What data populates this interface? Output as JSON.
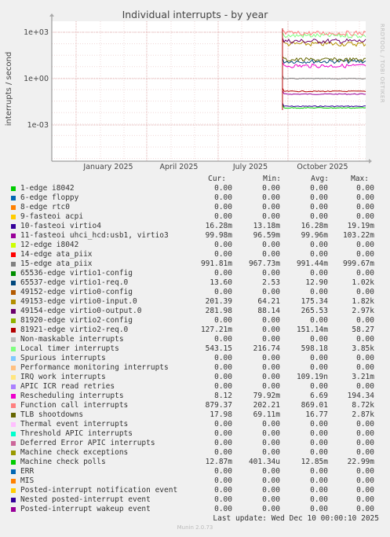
{
  "title": "Individual interrupts - by year",
  "side_credit": "RRDTOOL / TOBI OETIKER",
  "footer": "Munin 2.0.73",
  "last_update": "Last update: Wed Dec 10 00:00:10 2025",
  "columns": {
    "cur": "Cur:",
    "min": "Min:",
    "avg": "Avg:",
    "max": "Max:"
  },
  "chart_data": {
    "type": "line",
    "title": "Individual interrupts - by year",
    "ylabel": "interrupts / second",
    "y_scale": "log",
    "y_ticks": [
      "1e+03",
      "1e+00",
      "1e-03"
    ],
    "x_ticks": [
      "January 2025",
      "April 2025",
      "July 2025",
      "October 2025"
    ],
    "data_start": "September 2025",
    "grid": true,
    "series": [
      {
        "name": "1-edge      i8042",
        "color": "#00cc00",
        "cur": "0.00",
        "min": "0.00",
        "avg": "0.00",
        "max": "0.00"
      },
      {
        "name": "6-edge      floppy",
        "color": "#0066b3",
        "cur": "0.00",
        "min": "0.00",
        "avg": "0.00",
        "max": "0.00"
      },
      {
        "name": "8-edge      rtc0",
        "color": "#ff8000",
        "cur": "0.00",
        "min": "0.00",
        "avg": "0.00",
        "max": "0.00"
      },
      {
        "name": "9-fasteoi   acpi",
        "color": "#ffcc00",
        "cur": "0.00",
        "min": "0.00",
        "avg": "0.00",
        "max": "0.00"
      },
      {
        "name": "10-fasteoi   virtio4",
        "color": "#330099",
        "cur": "16.28m",
        "min": "13.18m",
        "avg": "16.28m",
        "max": "19.19m"
      },
      {
        "name": "11-fasteoi   uhci_hcd:usb1, virtio3",
        "color": "#990099",
        "cur": "99.98m",
        "min": "96.59m",
        "avg": "99.96m",
        "max": "103.22m"
      },
      {
        "name": "12-edge      i8042",
        "color": "#ccff00",
        "cur": "0.00",
        "min": "0.00",
        "avg": "0.00",
        "max": "0.00"
      },
      {
        "name": "14-edge      ata_piix",
        "color": "#ff0000",
        "cur": "0.00",
        "min": "0.00",
        "avg": "0.00",
        "max": "0.00"
      },
      {
        "name": "15-edge      ata_piix",
        "color": "#808080",
        "cur": "991.81m",
        "min": "967.73m",
        "avg": "991.44m",
        "max": "999.67m"
      },
      {
        "name": "65536-edge      virtio1-config",
        "color": "#008f00",
        "cur": "0.00",
        "min": "0.00",
        "avg": "0.00",
        "max": "0.00"
      },
      {
        "name": "65537-edge      virtio1-req.0",
        "color": "#00487d",
        "cur": "13.60",
        "min": "2.53",
        "avg": "12.90",
        "max": "1.02k"
      },
      {
        "name": "49152-edge      virtio0-config",
        "color": "#b35a00",
        "cur": "0.00",
        "min": "0.00",
        "avg": "0.00",
        "max": "0.00"
      },
      {
        "name": "49153-edge      virtio0-input.0",
        "color": "#b38f00",
        "cur": "201.39",
        "min": "64.21",
        "avg": "175.34",
        "max": "1.82k"
      },
      {
        "name": "49154-edge      virtio0-output.0",
        "color": "#6b006b",
        "cur": "281.98",
        "min": "88.14",
        "avg": "265.53",
        "max": "2.97k"
      },
      {
        "name": "81920-edge      virtio2-config",
        "color": "#8fb300",
        "cur": "0.00",
        "min": "0.00",
        "avg": "0.00",
        "max": "0.00"
      },
      {
        "name": "81921-edge      virtio2-req.0",
        "color": "#b30000",
        "cur": "127.21m",
        "min": "0.00",
        "avg": "151.14m",
        "max": "58.27"
      },
      {
        "name": "Non-maskable interrupts",
        "color": "#bebebe",
        "cur": "0.00",
        "min": "0.00",
        "avg": "0.00",
        "max": "0.00"
      },
      {
        "name": "Local timer interrupts",
        "color": "#80ff80",
        "cur": "543.15",
        "min": "216.74",
        "avg": "598.18",
        "max": "3.85k"
      },
      {
        "name": "Spurious interrupts",
        "color": "#80c9ff",
        "cur": "0.00",
        "min": "0.00",
        "avg": "0.00",
        "max": "0.00"
      },
      {
        "name": "Performance monitoring interrupts",
        "color": "#ffc080",
        "cur": "0.00",
        "min": "0.00",
        "avg": "0.00",
        "max": "0.00"
      },
      {
        "name": "IRQ work interrupts",
        "color": "#ffe680",
        "cur": "0.00",
        "min": "0.00",
        "avg": "109.19n",
        "max": "3.21m"
      },
      {
        "name": "APIC ICR read retries",
        "color": "#aa80ff",
        "cur": "0.00",
        "min": "0.00",
        "avg": "0.00",
        "max": "0.00"
      },
      {
        "name": "Rescheduling interrupts",
        "color": "#ee00cc",
        "cur": "8.12",
        "min": "79.92m",
        "avg": "6.69",
        "max": "194.34"
      },
      {
        "name": "Function call interrupts",
        "color": "#ff8080",
        "cur": "879.37",
        "min": "202.21",
        "avg": "869.01",
        "max": "8.72k"
      },
      {
        "name": "TLB shootdowns",
        "color": "#666600",
        "cur": "17.98",
        "min": "69.11m",
        "avg": "16.77",
        "max": "2.87k"
      },
      {
        "name": "Thermal event interrupts",
        "color": "#ffbfff",
        "cur": "0.00",
        "min": "0.00",
        "avg": "0.00",
        "max": "0.00"
      },
      {
        "name": "Threshold APIC interrupts",
        "color": "#00ffcc",
        "cur": "0.00",
        "min": "0.00",
        "avg": "0.00",
        "max": "0.00"
      },
      {
        "name": "Deferred Error APIC interrupts",
        "color": "#cc6699",
        "cur": "0.00",
        "min": "0.00",
        "avg": "0.00",
        "max": "0.00"
      },
      {
        "name": "Machine check exceptions",
        "color": "#999900",
        "cur": "0.00",
        "min": "0.00",
        "avg": "0.00",
        "max": "0.00"
      },
      {
        "name": "Machine check polls",
        "color": "#00cc00",
        "cur": "12.87m",
        "min": "401.34u",
        "avg": "12.85m",
        "max": "22.99m"
      },
      {
        "name": "ERR",
        "color": "#0066b3",
        "cur": "0.00",
        "min": "0.00",
        "avg": "0.00",
        "max": "0.00"
      },
      {
        "name": "MIS",
        "color": "#ff8000",
        "cur": "0.00",
        "min": "0.00",
        "avg": "0.00",
        "max": "0.00"
      },
      {
        "name": "Posted-interrupt notification event",
        "color": "#ffcc00",
        "cur": "0.00",
        "min": "0.00",
        "avg": "0.00",
        "max": "0.00"
      },
      {
        "name": "Nested posted-interrupt event",
        "color": "#330099",
        "cur": "0.00",
        "min": "0.00",
        "avg": "0.00",
        "max": "0.00"
      },
      {
        "name": "Posted-interrupt wakeup event",
        "color": "#990099",
        "cur": "0.00",
        "min": "0.00",
        "avg": "0.00",
        "max": "0.00"
      }
    ]
  }
}
